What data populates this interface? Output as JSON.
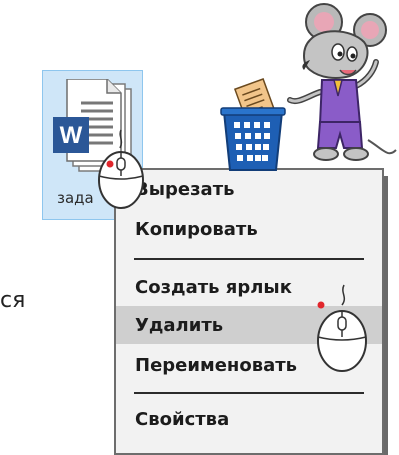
{
  "desktop": {
    "file_name": "зада",
    "file_icon": "word-document-icon"
  },
  "left_text": "ся",
  "context_menu": {
    "items": [
      {
        "label": "Вырезать"
      },
      {
        "label": "Копировать"
      },
      {
        "label": "Создать ярлык"
      },
      {
        "label": "Удалить",
        "highlighted": true
      },
      {
        "label": "Переименовать"
      },
      {
        "label": "Свойства"
      }
    ]
  },
  "illustration": {
    "mouse_character": "mouse-mascot",
    "recycle_bin": "recycle-bin-icon",
    "cursor_icon": "computer-mouse-icon"
  },
  "colors": {
    "selection_bg": "#cfe6f8",
    "menu_bg": "#f2f2f2",
    "highlight": "#cfcfcf",
    "word_blue": "#2b5797",
    "bin_blue": "#1e5fb4"
  }
}
